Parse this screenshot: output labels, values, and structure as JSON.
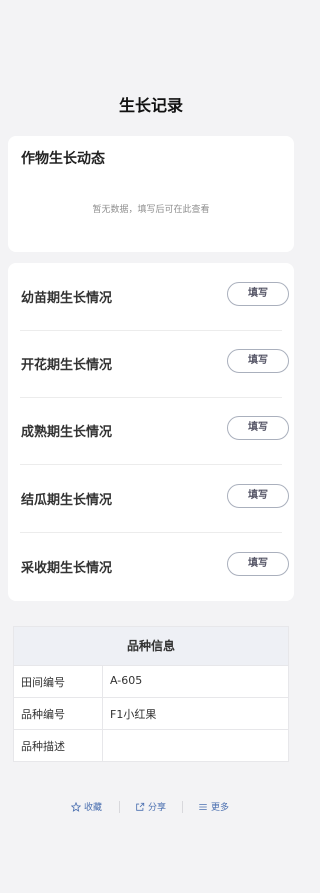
{
  "page": {
    "title": "生长记录"
  },
  "dynamics": {
    "title": "作物生长动态",
    "empty_text": "暂无数据，填写后可在此查看"
  },
  "stages": [
    {
      "label": "幼苗期生长情况",
      "button": "填写"
    },
    {
      "label": "开花期生长情况",
      "button": "填写"
    },
    {
      "label": "成熟期生长情况",
      "button": "填写"
    },
    {
      "label": "结瓜期生长情况",
      "button": "填写"
    },
    {
      "label": "采收期生长情况",
      "button": "填写"
    }
  ],
  "variety": {
    "header": "品种信息",
    "rows": [
      {
        "key": "田间编号",
        "value": "A-605"
      },
      {
        "key": "品种编号",
        "value": "F1小红果"
      },
      {
        "key": "品种描述",
        "value": ""
      }
    ]
  },
  "footer": {
    "favorite": {
      "label": "收藏",
      "icon": "star-icon"
    },
    "share": {
      "label": "分享",
      "icon": "share-icon"
    },
    "more": {
      "label": "更多",
      "icon": "menu-icon"
    },
    "accent": "#4a6fb0"
  }
}
